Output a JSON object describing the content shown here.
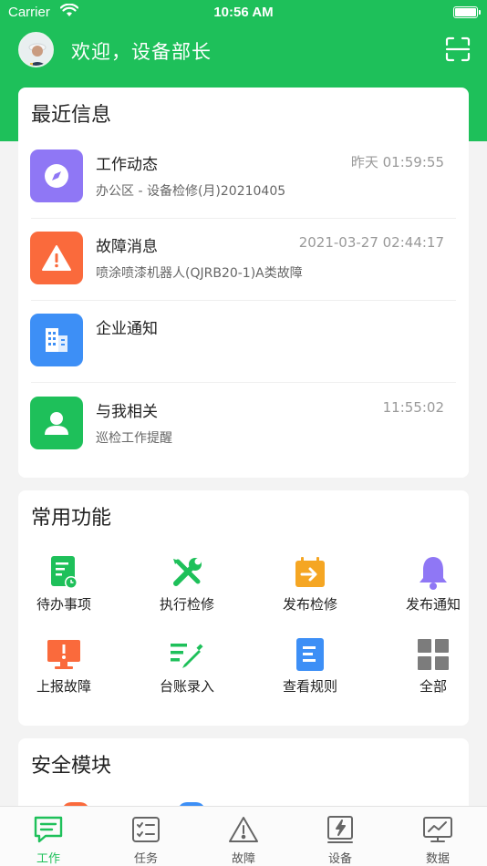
{
  "status_bar": {
    "carrier": "Carrier",
    "time": "10:56 AM"
  },
  "header": {
    "welcome": "欢迎，设备部长"
  },
  "recent": {
    "title": "最近信息",
    "items": [
      {
        "title": "工作动态",
        "time": "昨天 01:59:55",
        "subtitle": "办公区 - 设备检修(月)20210405",
        "icon": "compass-icon",
        "color": "#8f77f5"
      },
      {
        "title": "故障消息",
        "time": "2021-03-27 02:44:17",
        "subtitle": "喷涂喷漆机器人(QJRB20-1)A类故障",
        "icon": "warning-icon",
        "color": "#fa6a3c"
      },
      {
        "title": "企业通知",
        "time": "",
        "subtitle": "",
        "icon": "building-icon",
        "color": "#3d8ff6"
      },
      {
        "title": "与我相关",
        "time": "11:55:02",
        "subtitle": "巡检工作提醒",
        "icon": "user-icon",
        "color": "#1ec05a"
      }
    ]
  },
  "functions": {
    "title": "常用功能",
    "items": [
      {
        "label": "待办事项",
        "icon": "todo-doc-icon"
      },
      {
        "label": "执行检修",
        "icon": "wrench-screwdriver-icon"
      },
      {
        "label": "发布检修",
        "icon": "calendar-arrow-icon"
      },
      {
        "label": "发布通知",
        "icon": "bell-icon"
      },
      {
        "label": "上报故障",
        "icon": "report-monitor-icon"
      },
      {
        "label": "台账录入",
        "icon": "pencil-entry-icon"
      },
      {
        "label": "查看规则",
        "icon": "document-icon"
      },
      {
        "label": "全部",
        "icon": "grid-icon"
      }
    ]
  },
  "safety": {
    "title": "安全模块"
  },
  "tabbar": {
    "items": [
      {
        "label": "工作",
        "icon": "chat-icon",
        "active": true
      },
      {
        "label": "任务",
        "icon": "task-card-icon"
      },
      {
        "label": "故障",
        "icon": "warning-outline-icon"
      },
      {
        "label": "设备",
        "icon": "device-bolt-icon"
      },
      {
        "label": "数据",
        "icon": "chart-monitor-icon"
      }
    ]
  },
  "colors": {
    "primary": "#1ec05a",
    "purple": "#8f77f5",
    "orange": "#fa6a3c",
    "blue": "#3d8ff6",
    "gray": "#7c7c7c"
  }
}
